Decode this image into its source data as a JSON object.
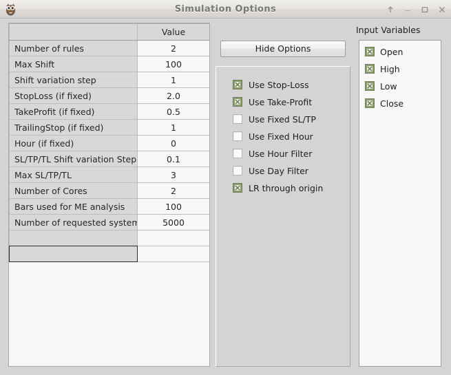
{
  "window": {
    "title": "Simulation Options",
    "icon": "owl-icon",
    "buttons": [
      {
        "name": "shade-button",
        "glyph": "up-arrow"
      },
      {
        "name": "minimize-button",
        "glyph": "minus"
      },
      {
        "name": "maximize-button",
        "glyph": "square"
      },
      {
        "name": "close-button",
        "glyph": "cross"
      }
    ]
  },
  "options_table": {
    "headers": [
      "",
      "Value"
    ],
    "rows": [
      {
        "name": "Number of rules",
        "value": "2"
      },
      {
        "name": "Max Shift",
        "value": "100"
      },
      {
        "name": "Shift variation step",
        "value": "1"
      },
      {
        "name": "StopLoss (if fixed)",
        "value": "2.0"
      },
      {
        "name": "TakeProfit (if fixed)",
        "value": "0.5"
      },
      {
        "name": "TrailingStop (if fixed)",
        "value": "1"
      },
      {
        "name": "Hour (if fixed)",
        "value": "0"
      },
      {
        "name": "SL/TP/TL Shift variation Step",
        "value": "0.1"
      },
      {
        "name": "Max SL/TP/TL",
        "value": "3"
      },
      {
        "name": "Number of Cores",
        "value": "2"
      },
      {
        "name": "Bars used for ME analysis",
        "value": "100"
      },
      {
        "name": "Number of requested systems",
        "value": "5000"
      },
      {
        "name": "",
        "value": ""
      },
      {
        "name": "",
        "value": ""
      }
    ]
  },
  "middle": {
    "hide_options_label": "Hide Options",
    "checkboxes": [
      {
        "label": "Use Stop-Loss",
        "checked": true
      },
      {
        "label": "Use Take-Profit",
        "checked": true
      },
      {
        "label": "Use Fixed SL/TP",
        "checked": false
      },
      {
        "label": "Use Fixed Hour",
        "checked": false
      },
      {
        "label": "Use Hour Filter",
        "checked": false
      },
      {
        "label": "Use Day Filter",
        "checked": false
      },
      {
        "label": "LR through origin",
        "checked": true
      }
    ]
  },
  "input_variables": {
    "title": "Input Variables",
    "items": [
      {
        "label": "Open",
        "checked": true
      },
      {
        "label": "High",
        "checked": true
      },
      {
        "label": "Low",
        "checked": true
      },
      {
        "label": "Close",
        "checked": true
      }
    ]
  },
  "colors": {
    "window_bg": "#d4d4d4",
    "panel_bg": "#f7f7f7",
    "row_name_bg": "#d8d8d8",
    "checkbox_checked": "#8a9b6e",
    "title_text": "#7a7872"
  }
}
